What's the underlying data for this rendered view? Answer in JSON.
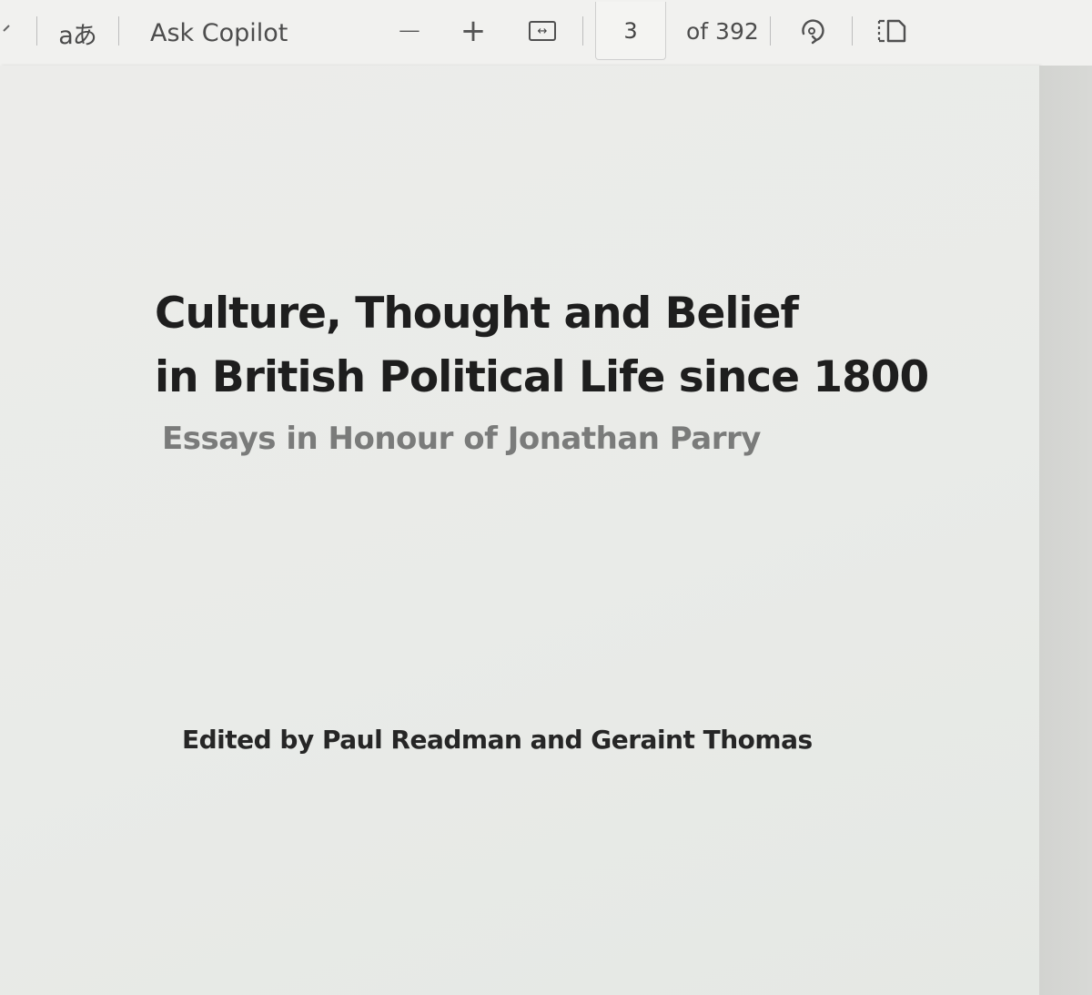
{
  "toolbar": {
    "read_aloud_label": "aあ",
    "ask_copilot_label": "Ask Copilot",
    "zoom_out_label": "−",
    "zoom_in_label": "+",
    "fit_width_label": "↔",
    "current_page": "3",
    "page_total_label": "of 392"
  },
  "icons": {
    "back": "chevron-left-icon",
    "read_aloud": "read-aloud-icon",
    "zoom_out": "minus-icon",
    "zoom_in": "plus-icon",
    "fit_width": "fit-to-width-icon",
    "rotate": "rotate-icon",
    "page_view": "page-view-icon"
  },
  "document": {
    "title_line_1": "Culture, Thought and Belief",
    "title_line_2": "in British Political Life since 1800",
    "subtitle": "Essays in Honour of Jonathan Parry",
    "editors": "Edited by Paul Readman and Geraint Thomas"
  },
  "colors": {
    "toolbar_background": "#f1f1ef",
    "page_background": "#ebebe9",
    "title_text": "#1e1e1e",
    "subtitle_text": "#7a7b7a"
  }
}
